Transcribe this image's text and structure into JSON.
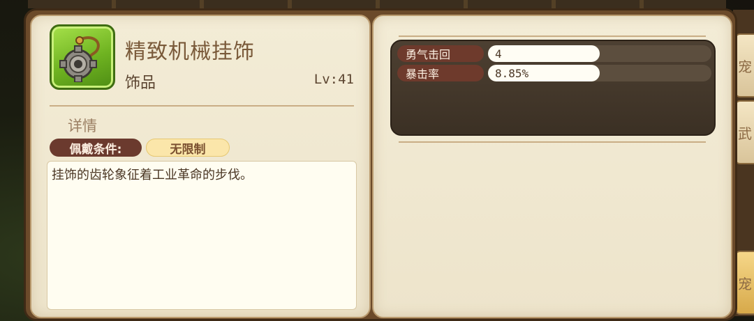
{
  "item": {
    "name": "精致机械挂饰",
    "type": "饰品",
    "level": "Lv:41",
    "icon": "mechanical-gear-pendant-icon"
  },
  "details": {
    "heading": "详情",
    "requirement_label": "佩戴条件:",
    "requirement_value": "无限制",
    "description": "挂饰的齿轮象征着工业革命的步伐。"
  },
  "stats": [
    {
      "name": "勇气击回",
      "value": "4"
    },
    {
      "name": "暴击率",
      "value": "8.85%"
    }
  ],
  "side_tabs": [
    {
      "label": "宠"
    },
    {
      "label": "武"
    },
    {
      "label": "宠"
    }
  ],
  "colors": {
    "label_pill": "#6e3a2c",
    "value_pill": "#fffdf4",
    "panel_dark": "#3b3024",
    "page": "#f3ecd6",
    "icon_green": "#6fb321"
  }
}
